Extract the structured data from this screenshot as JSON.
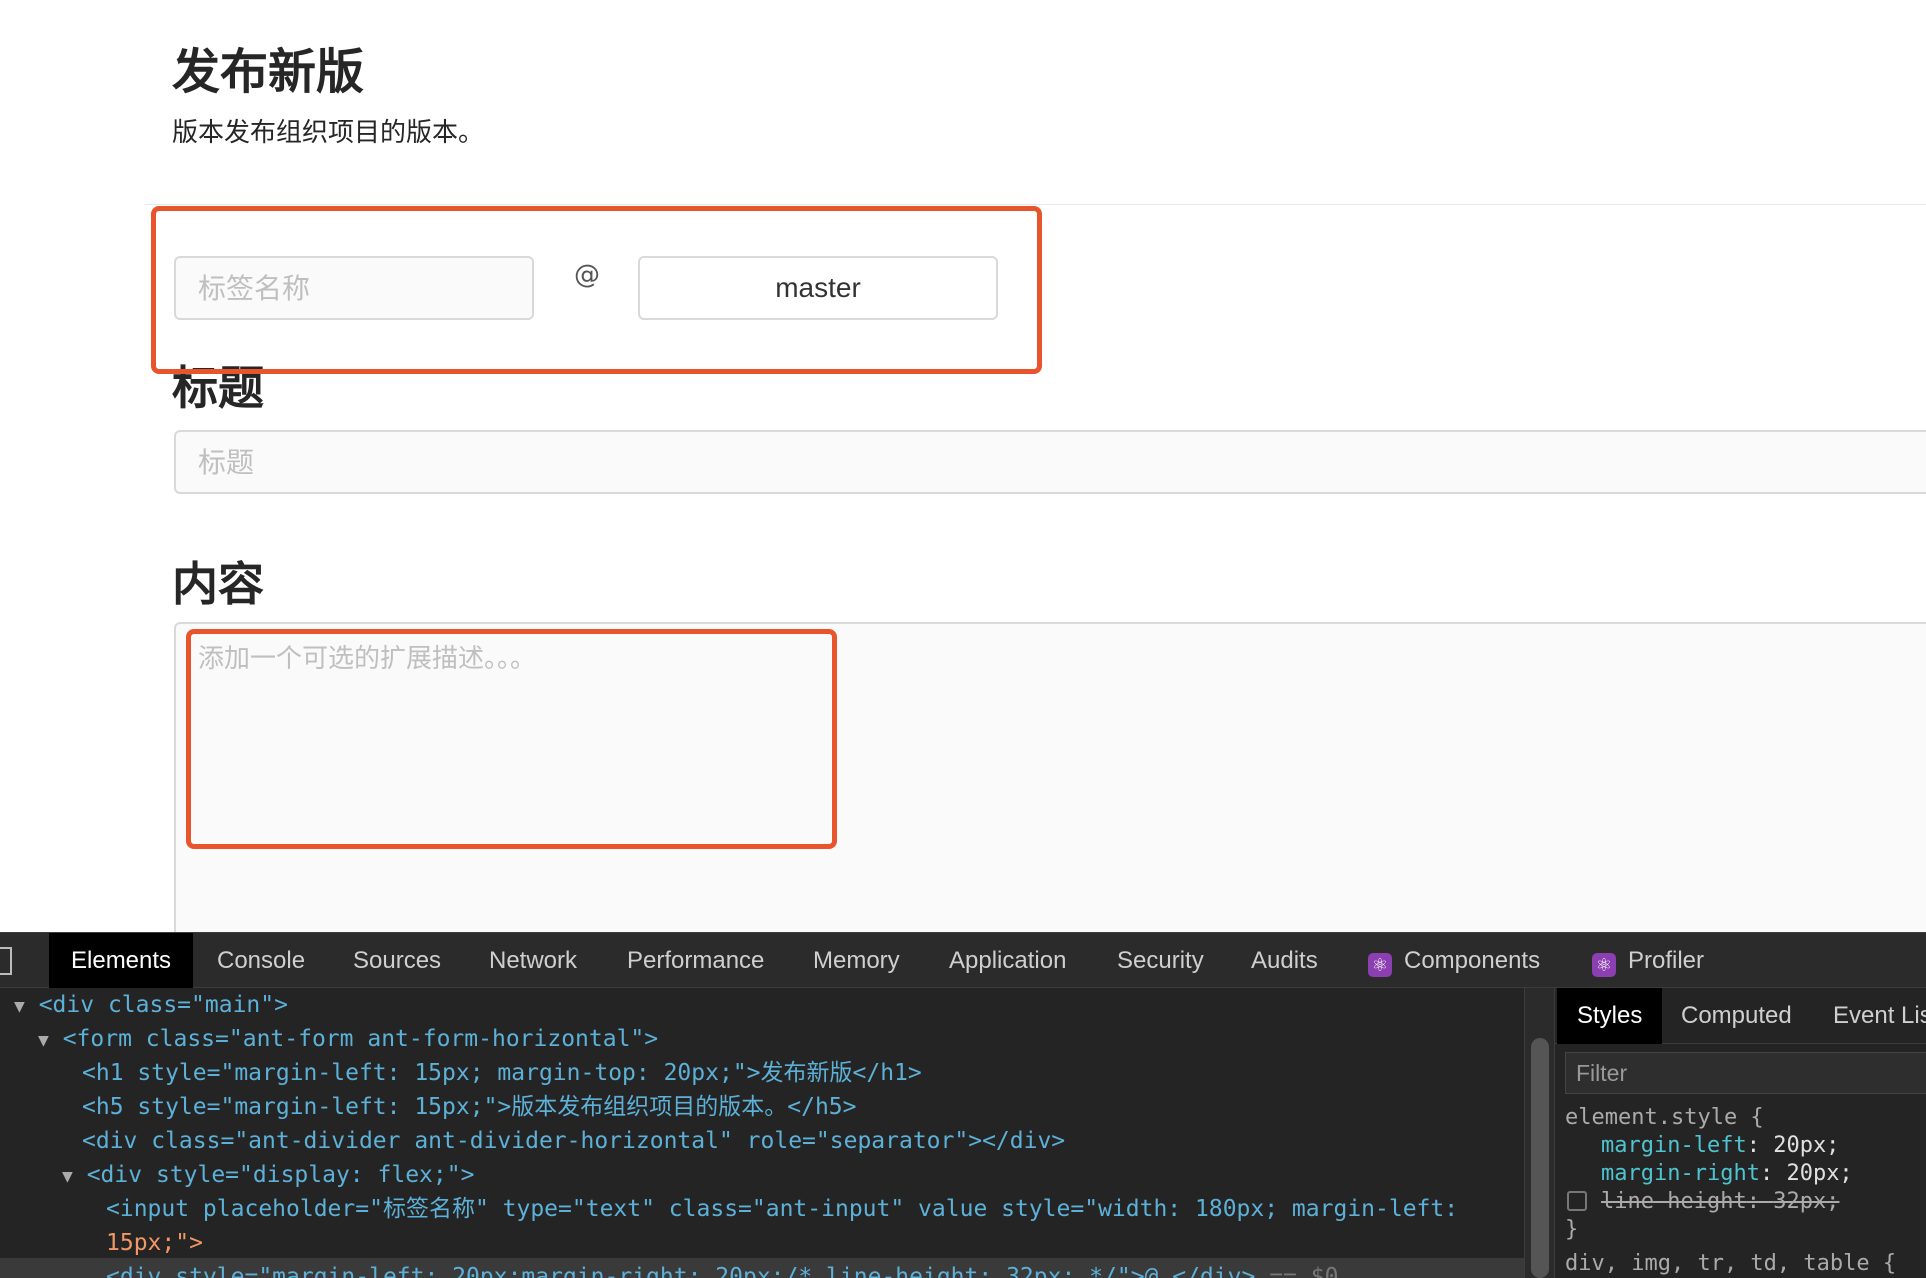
{
  "page": {
    "title": "发布新版",
    "subtitle": "版本发布组织项目的版本。",
    "tag_input": {
      "placeholder": "标签名称",
      "value": ""
    },
    "at_sign": "@",
    "branch": "master",
    "title_section": {
      "label": "标题",
      "placeholder": "标题"
    },
    "content_section": {
      "label": "内容",
      "placeholder": "添加一个可选的扩展描述。。。"
    }
  },
  "devtools": {
    "tabs": [
      "Elements",
      "Console",
      "Sources",
      "Network",
      "Performance",
      "Memory",
      "Application",
      "Security",
      "Audits",
      "Components",
      "Profiler"
    ],
    "active_tab": "Elements",
    "dom_lines": {
      "l1": "<div class=\"main\">",
      "l2": "<form class=\"ant-form ant-form-horizontal\">",
      "l3": "<h1 style=\"margin-left: 15px; margin-top: 20px;\">发布新版</h1>",
      "l4": "<h5 style=\"margin-left: 15px;\">版本发布组织项目的版本。</h5>",
      "l5": "<div class=\"ant-divider ant-divider-horizontal\" role=\"separator\"></div>",
      "l6": "<div style=\"display: flex;\">",
      "l7a": "<input placeholder=\"标签名称\" type=\"text\" class=\"ant-input\" value style=\"width: 180px; margin-left:",
      "l7b": "15px;\">",
      "l8": "<div style=\"margin-left: 20px;margin-right: 20px;/* line-height: 32px; */\">@ </div>",
      "l8_suffix": "== $0"
    },
    "styles_pane": {
      "tabs": [
        "Styles",
        "Computed",
        "Event Lis"
      ],
      "active_tab": "Styles",
      "filter_placeholder": "Filter",
      "rule_selector": "element.style {",
      "properties": [
        {
          "name": "margin-left",
          "value": "20px;",
          "enabled": true
        },
        {
          "name": "margin-right",
          "value": "20px;",
          "enabled": true
        },
        {
          "name": "line-height",
          "value": "32px;",
          "enabled": false
        }
      ],
      "rule_close": "}",
      "next_rule": "div, img, tr, td, table {"
    }
  },
  "colors": {
    "annotation": "#e8542c",
    "accent": "#8b3fb0"
  }
}
